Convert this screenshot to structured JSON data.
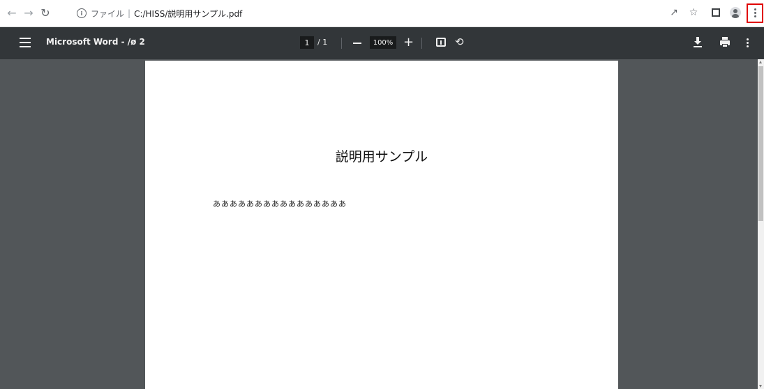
{
  "browser": {
    "back_icon": "arrow-left",
    "forward_icon": "arrow-right",
    "reload_icon": "reload",
    "address": {
      "scheme_label": "ファイル",
      "url": "C:/HISS/説明用サンプル.pdf"
    },
    "toolbar_icons": [
      "share-icon",
      "star-icon",
      "side-panel-icon",
      "profile-avatar-icon",
      "chrome-menu-icon"
    ],
    "highlight_color": "#e00000"
  },
  "pdf_toolbar": {
    "title": "Microsoft Word - /ø 2",
    "page_current": "1",
    "page_total": "/ 1",
    "zoom": "100%",
    "colors": {
      "bar": "#323639",
      "input": "#191b1c"
    }
  },
  "document": {
    "heading": "説明用サンプル",
    "body": "ああああああああああああああああ"
  },
  "viewer": {
    "background": "#525659"
  }
}
